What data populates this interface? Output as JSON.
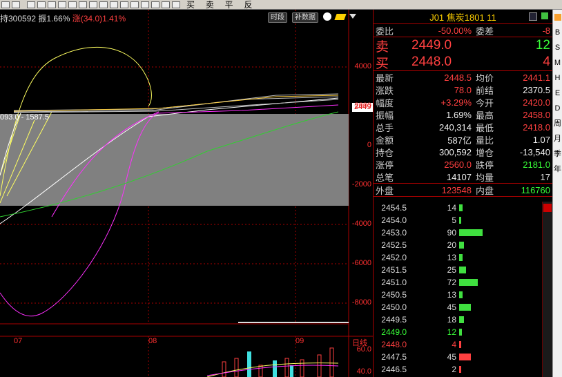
{
  "toolbar": {
    "chars": "买 卖 平 反"
  },
  "info": {
    "prefix": "持300592",
    "swing": "振1.66%",
    "change": "涨(34.0)1.41%",
    "btn1": "时段",
    "btn2": "补数据"
  },
  "chart": {
    "series_label": "093.0 - 1587.5",
    "price_flag": "2449",
    "y_ticks": [
      "4000",
      "2000",
      "0",
      "-2000",
      "-4000",
      "-6000",
      "-8000"
    ],
    "x_dates": [
      "07",
      "08",
      "09"
    ],
    "x_unit": "日线",
    "vol_ticks": [
      "60.0",
      "40.0"
    ],
    "colors": {
      "yellow": "#ffff60",
      "white": "#ffffff",
      "magenta": "#ff30ff",
      "green": "#30d030",
      "band": "#808080"
    }
  },
  "quote": {
    "title": "J01  焦炭1801  11",
    "weibi": {
      "label": "委比",
      "value": "-50.00%",
      "label2": "委差",
      "value2": "-8"
    },
    "sell": {
      "label": "卖",
      "price": "2449.0",
      "qty": "12"
    },
    "buy": {
      "label": "买",
      "price": "2448.0",
      "qty": "4"
    },
    "rows": [
      {
        "l1": "最新",
        "v1": "2448.5",
        "c1": "red",
        "l2": "均价",
        "v2": "2441.1",
        "c2": "red"
      },
      {
        "l1": "涨跌",
        "v1": "78.0",
        "c1": "red",
        "l2": "前结",
        "v2": "2370.5",
        "c2": "white"
      },
      {
        "l1": "幅度",
        "v1": "+3.29%",
        "c1": "red",
        "l2": "今开",
        "v2": "2420.0",
        "c2": "red"
      },
      {
        "l1": "振幅",
        "v1": "1.69%",
        "c1": "white",
        "l2": "最高",
        "v2": "2458.0",
        "c2": "red"
      },
      {
        "l1": "总手",
        "v1": "240,314",
        "c1": "white",
        "l2": "最低",
        "v2": "2418.0",
        "c2": "red"
      },
      {
        "l1": "金额",
        "v1": "587亿",
        "c1": "white",
        "l2": "量比",
        "v2": "1.07",
        "c2": "white"
      },
      {
        "l1": "持仓",
        "v1": "300,592",
        "c1": "white",
        "l2": "增仓",
        "v2": "-13,540",
        "c2": "white"
      },
      {
        "l1": "涨停",
        "v1": "2560.0",
        "c1": "red",
        "l2": "跌停",
        "v2": "2181.0",
        "c2": "green"
      },
      {
        "l1": "总笔",
        "v1": "14107",
        "c1": "white",
        "l2": "均量",
        "v2": "17",
        "c2": "white"
      }
    ],
    "outer": {
      "label": "外盘",
      "value": "123548",
      "label2": "内盘",
      "value2": "116760"
    }
  },
  "depth": [
    {
      "price": "2454.5",
      "qty": "14",
      "ratio": 0.16,
      "color": "green"
    },
    {
      "price": "2454.0",
      "qty": "5",
      "ratio": 0.06,
      "color": "green"
    },
    {
      "price": "2453.0",
      "qty": "90",
      "ratio": 1.0,
      "color": "green"
    },
    {
      "price": "2452.5",
      "qty": "20",
      "ratio": 0.22,
      "color": "green"
    },
    {
      "price": "2452.0",
      "qty": "13",
      "ratio": 0.14,
      "color": "green"
    },
    {
      "price": "2451.5",
      "qty": "25",
      "ratio": 0.28,
      "color": "green"
    },
    {
      "price": "2451.0",
      "qty": "72",
      "ratio": 0.8,
      "color": "green"
    },
    {
      "price": "2450.5",
      "qty": "13",
      "ratio": 0.14,
      "color": "green"
    },
    {
      "price": "2450.0",
      "qty": "45",
      "ratio": 0.5,
      "color": "green"
    },
    {
      "price": "2449.5",
      "qty": "18",
      "ratio": 0.2,
      "color": "green"
    },
    {
      "price": "2449.0",
      "qty": "12",
      "ratio": 0.13,
      "color": "green",
      "pcolor": "green"
    },
    {
      "price": "2448.0",
      "qty": "4",
      "ratio": 0.05,
      "color": "red",
      "pcolor": "red"
    },
    {
      "price": "2447.5",
      "qty": "45",
      "ratio": 0.5,
      "color": "red"
    },
    {
      "price": "2446.5",
      "qty": "2",
      "ratio": 0.03,
      "color": "red"
    }
  ],
  "side": {
    "items": [
      "B",
      "S",
      "M",
      "H",
      "E",
      "D",
      "周",
      "月",
      "季",
      "年"
    ]
  }
}
